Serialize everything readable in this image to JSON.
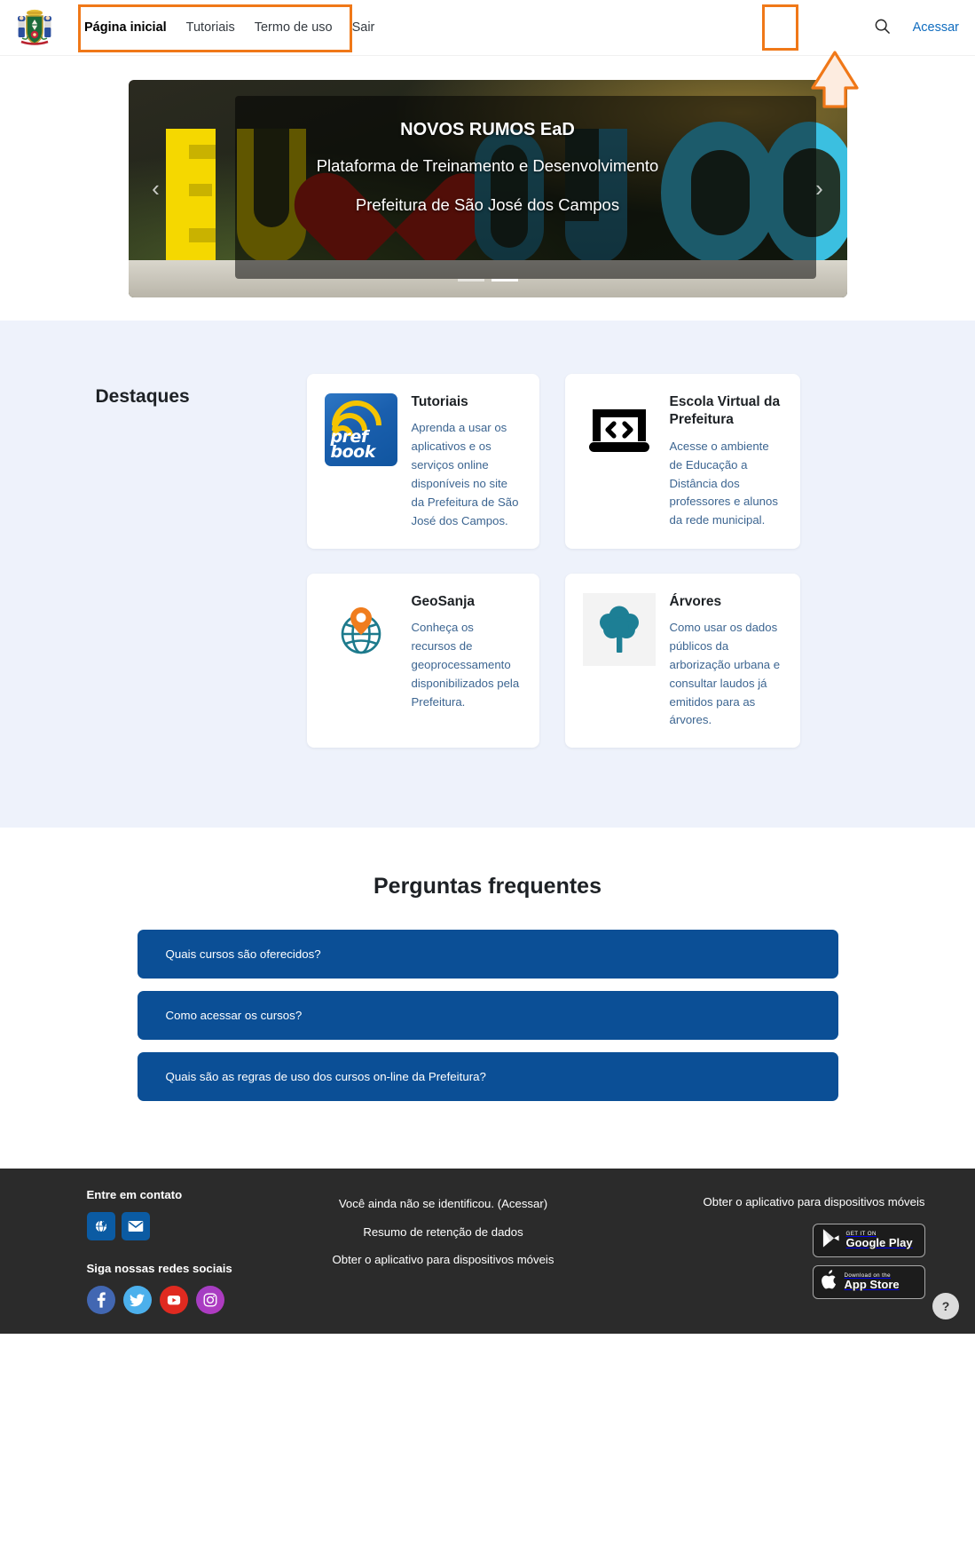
{
  "header": {
    "logo_alt": "Brasão da Prefeitura de São José dos Campos",
    "nav": [
      {
        "label": "Página inicial",
        "active": true
      },
      {
        "label": "Tutoriais",
        "active": false
      },
      {
        "label": "Termo de uso",
        "active": false
      },
      {
        "label": "Sair",
        "active": false
      }
    ],
    "search_icon": "search-icon",
    "login_label": "Acessar"
  },
  "banner": {
    "title": "NOVOS RUMOS EaD",
    "subtitle1": "Plataforma de Treinamento e Desenvolvimento",
    "subtitle2": "Prefeitura de São José dos Campos",
    "prev_label": "‹",
    "next_label": "›",
    "slides": 2,
    "active_slide": 2,
    "image_alt": "EU ♥ SJC"
  },
  "destaques": {
    "title": "Destaques",
    "cards": [
      {
        "icon": "prefbook-icon",
        "icon_text_line1": "pref",
        "icon_text_line2": "book",
        "title": "Tutoriais",
        "text": "Aprenda a usar os aplicativos e os serviços online disponíveis no site da Prefeitura de São José dos Campos."
      },
      {
        "icon": "laptop-code-icon",
        "title": "Escola Virtual da Prefeitura",
        "text": "Acesse o ambiente de Educação a Distância dos professores e alunos da rede municipal."
      },
      {
        "icon": "globe-pin-icon",
        "title": "GeoSanja",
        "text": "Conheça os recursos de geoprocessamento disponibilizados pela Prefeitura."
      },
      {
        "icon": "tree-icon",
        "title": "Árvores",
        "text": "Como usar os dados públicos da arborização urbana e consultar laudos já emitidos para as árvores."
      }
    ]
  },
  "faq": {
    "title": "Perguntas frequentes",
    "items": [
      "Quais cursos são oferecidos?",
      "Como acessar os cursos?",
      "Quais são as regras de uso dos cursos on-line da Prefeitura?"
    ]
  },
  "footer": {
    "contact_heading": "Entre em contato",
    "contact_icons": [
      "globe-icon",
      "envelope-icon"
    ],
    "social_heading": "Siga nossas redes sociais",
    "social_icons": [
      "facebook-icon",
      "twitter-icon",
      "youtube-icon",
      "instagram-icon"
    ],
    "links": [
      "Você ainda não se identificou. (Acessar)",
      "Resumo de retenção de dados",
      "Obter o aplicativo para dispositivos móveis"
    ],
    "app_heading": "Obter o aplicativo para dispositivos móveis",
    "badges": [
      {
        "small": "GET IT ON",
        "big": "Google Play",
        "icon": "google-play-icon"
      },
      {
        "small": "Download on the",
        "big": "App Store",
        "icon": "apple-icon"
      }
    ],
    "help_label": "?"
  },
  "colors": {
    "accent_blue": "#0f6cbf",
    "faq_blue": "#0b4f96",
    "highlight_orange": "#f07818",
    "destaques_bg": "#eef2fb",
    "footer_bg": "#2b2b2b",
    "card_text": "#3c6591"
  }
}
